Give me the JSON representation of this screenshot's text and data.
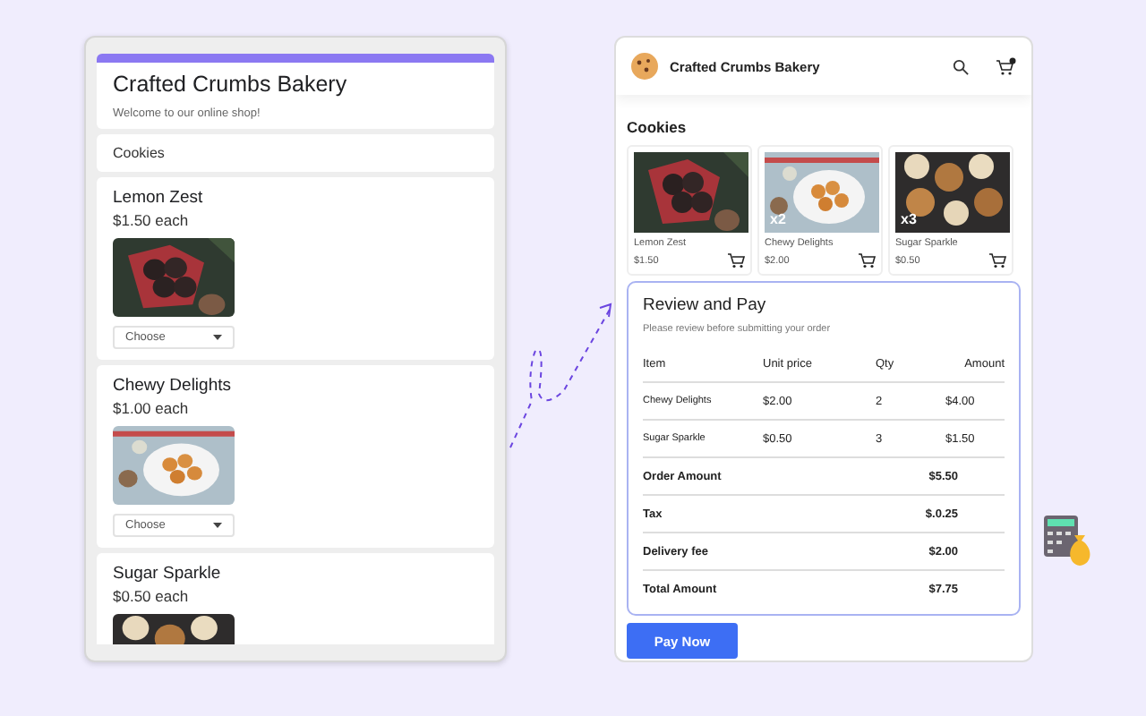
{
  "form": {
    "title": "Crafted Crumbs Bakery",
    "subtitle": "Welcome to our online shop!",
    "section": "Cookies",
    "items": [
      {
        "name": "Lemon Zest",
        "price": "$1.50 each",
        "select": {
          "placeholder": "Choose"
        }
      },
      {
        "name": "Chewy Delights",
        "price": "$1.00 each",
        "select": {
          "placeholder": "Choose"
        }
      },
      {
        "name": "Sugar Sparkle",
        "price": "$0.50 each"
      }
    ]
  },
  "shop": {
    "brand": "Crafted Crumbs Bakery",
    "section": "Cookies",
    "products": [
      {
        "name": "Lemon Zest",
        "price": "$1.50"
      },
      {
        "name": "Chewy Delights",
        "price": "$2.00",
        "quantity": "x2"
      },
      {
        "name": "Sugar Sparkle",
        "price": "$0.50",
        "quantity": "x3"
      }
    ],
    "review": {
      "title": "Review and Pay",
      "subtitle": "Please review before submitting your order",
      "columns": [
        "Item",
        "Unit price",
        "Qty",
        "Amount"
      ],
      "rows": [
        [
          "Chewy Delights",
          "$2.00",
          "2",
          "$4.00"
        ],
        [
          "Sugar Sparkle",
          "$0.50",
          "3",
          "$1.50"
        ]
      ],
      "totals": [
        {
          "label": "Order Amount",
          "value": "$5.50"
        },
        {
          "label": "Tax",
          "value": "$.0.25"
        },
        {
          "label": "Delivery fee",
          "value": "$2.00"
        },
        {
          "label": "Total Amount",
          "value": "$7.75"
        }
      ]
    },
    "button": "Pay Now"
  }
}
